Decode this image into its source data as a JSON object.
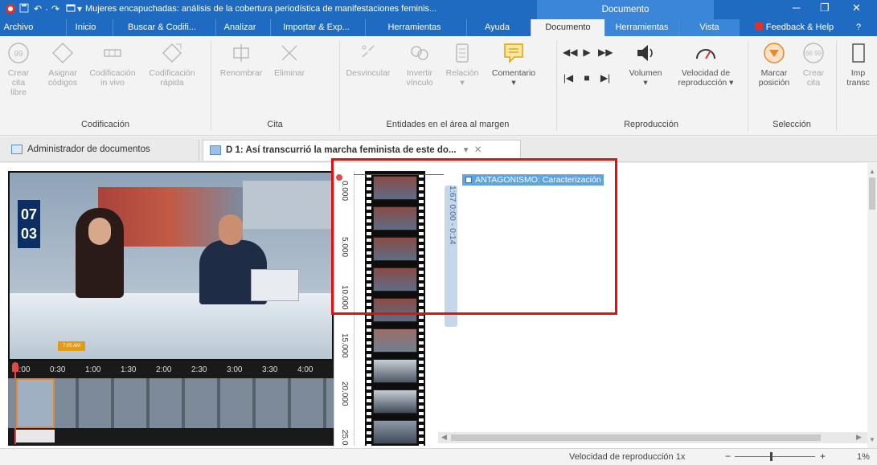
{
  "titlebar": {
    "title": "Mujeres encapuchadas: análisis de la cobertura periodística de manifestaciones feminis...",
    "context_group": "Documento",
    "minimize": "─",
    "restore": "❐",
    "close": "✕"
  },
  "tabs": {
    "archivo": "Archivo",
    "inicio": "Inicio",
    "buscar": "Buscar & Codifi...",
    "analizar": "Analizar",
    "importar": "Importar & Exp...",
    "herramientas1": "Herramientas",
    "ayuda": "Ayuda",
    "documento": "Documento",
    "herramientas2": "Herramientas",
    "vista": "Vista",
    "feedback": "Feedback & Help",
    "help_symbol": "?"
  },
  "ribbon": {
    "crear_cita": [
      "Crear cita",
      "libre"
    ],
    "asignar": [
      "Asignar",
      "códigos"
    ],
    "cod_vivo": [
      "Codificación",
      "in vivo"
    ],
    "cod_rapida": [
      "Codificación",
      "rápida"
    ],
    "renombrar": "Renombrar",
    "eliminar": "Eliminar",
    "desvincular": "Desvincular",
    "invertir": [
      "Invertir",
      "vínculo"
    ],
    "relacion": "Relación",
    "comentario": "Comentario",
    "volumen": "Volumen",
    "velocidad": [
      "Velocidad de",
      "reproducción"
    ],
    "marcar": [
      "Marcar",
      "posición"
    ],
    "crear_cita2": [
      "Crear",
      "cita"
    ],
    "imp": [
      "Imp",
      "transc"
    ],
    "group_codificacion": "Codificación",
    "group_cita": "Cita",
    "group_entidades": "Entidades en el área al margen",
    "group_reproduccion": "Reproducción",
    "group_seleccion": "Selección"
  },
  "doctabs": {
    "admin": "Administrador de documentos",
    "doc": "D 1: Así transcurrió la marcha feminista de este do...",
    "pin": "▾",
    "close": "✕"
  },
  "video": {
    "date_day": "07",
    "date_month": "03",
    "timeline_labels": [
      "0:00",
      "0:30",
      "1:00",
      "1:30",
      "2:00",
      "2:30",
      "3:00",
      "3:30",
      "4:00"
    ],
    "clock_text": "7:05 AM"
  },
  "ruler": {
    "labels": [
      "0.000",
      "5.000",
      "10.000",
      "15.000",
      "20.000",
      "25.0"
    ]
  },
  "margin": {
    "code": "ANTAGONISMO: Caracterización",
    "quote": "1:67 0:00 - 0:14"
  },
  "statusbar": {
    "speed_label": "Velocidad de reproducción 1x",
    "minus": "−",
    "plus": "+",
    "zoom": "1%"
  }
}
